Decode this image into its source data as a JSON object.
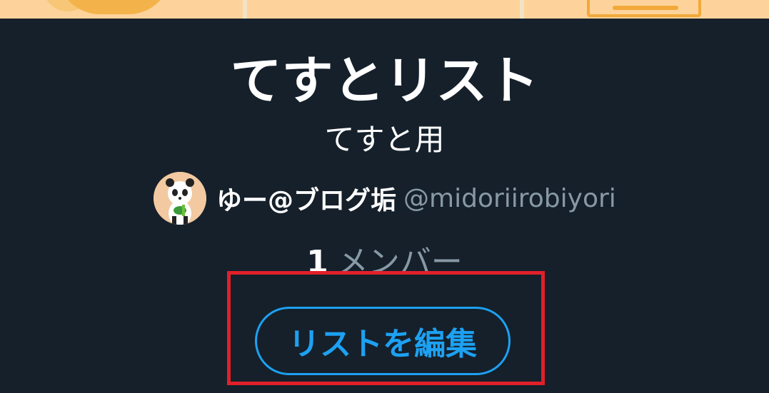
{
  "list": {
    "title": "てすとリスト",
    "description": "てすと用"
  },
  "owner": {
    "display_name": "ゆー@ブログ垢",
    "handle": "@midoriirobiyori",
    "avatar_icon": "panda-avatar-icon"
  },
  "members": {
    "count": "1",
    "label": "メンバー"
  },
  "actions": {
    "edit_label": "リストを編集"
  },
  "colors": {
    "background": "#15202b",
    "accent": "#1da1f2",
    "highlight": "#e0202a",
    "secondary_text": "#8899a6",
    "banner": "#fdd39b"
  }
}
